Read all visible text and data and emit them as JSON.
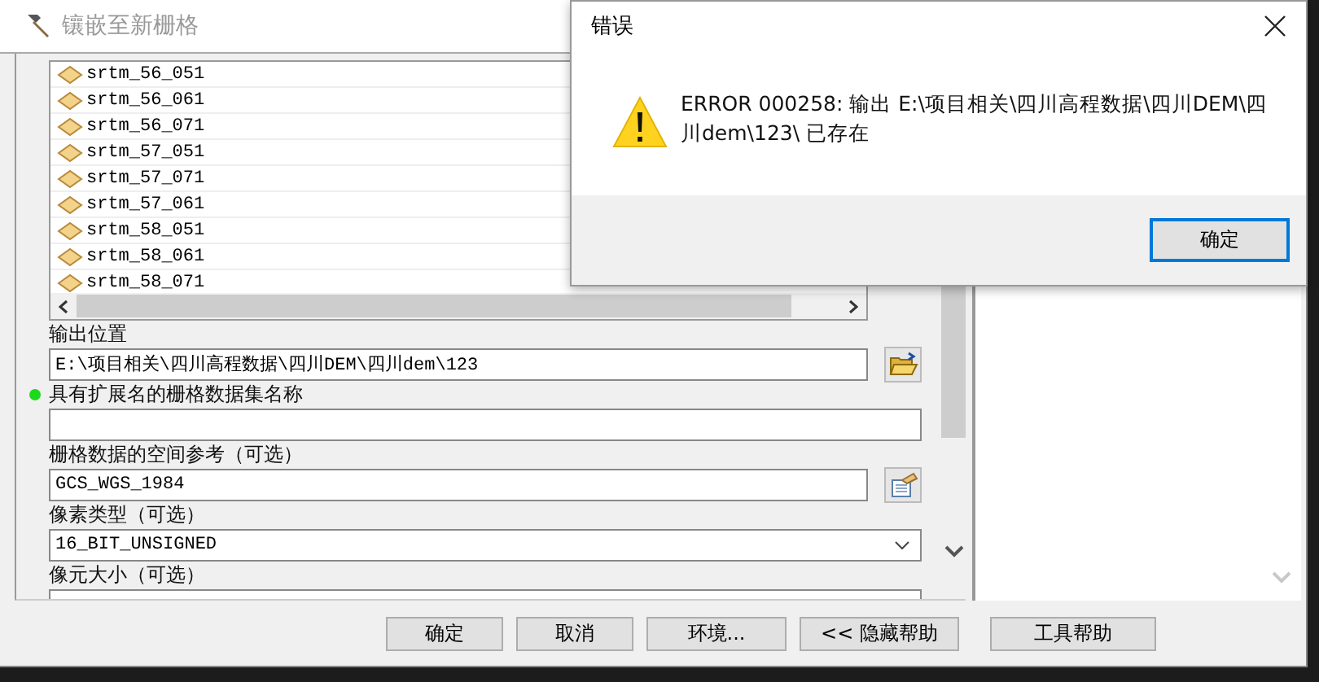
{
  "window": {
    "title": "镶嵌至新栅格"
  },
  "input_rasters": [
    {
      "name": "srtm_56_051"
    },
    {
      "name": "srtm_56_061"
    },
    {
      "name": "srtm_56_071"
    },
    {
      "name": "srtm_57_051"
    },
    {
      "name": "srtm_57_071"
    },
    {
      "name": "srtm_57_061"
    },
    {
      "name": "srtm_58_051"
    },
    {
      "name": "srtm_58_061"
    },
    {
      "name": "srtm_58_071"
    }
  ],
  "fields": [
    {
      "label": "输出位置",
      "value": "E:\\项目相关\\四川高程数据\\四川DEM\\四川dem\\123",
      "kind": "folder",
      "required": false
    },
    {
      "label": "具有扩展名的栅格数据集名称",
      "kind": "text",
      "required": true
    },
    {
      "label": "栅格数据的空间参考（可选）",
      "value": "GCS_WGS_1984",
      "kind": "spatial",
      "required": false
    },
    {
      "label": "像素类型（可选）",
      "value": "16_BIT_UNSIGNED",
      "kind": "dropdown",
      "required": false
    },
    {
      "label": "像元大小（可选）",
      "kind": "text",
      "required": false
    }
  ],
  "buttons": [
    "确定",
    "取消",
    "环境...",
    "<< 隐藏帮助",
    "工具帮助"
  ],
  "error_dialog": {
    "title": "错误",
    "message": "ERROR 000258: 输出 E:\\项目相关\\四川高程数据\\四川DEM\\四川dem\\123\\ 已存在",
    "button": "确定"
  }
}
